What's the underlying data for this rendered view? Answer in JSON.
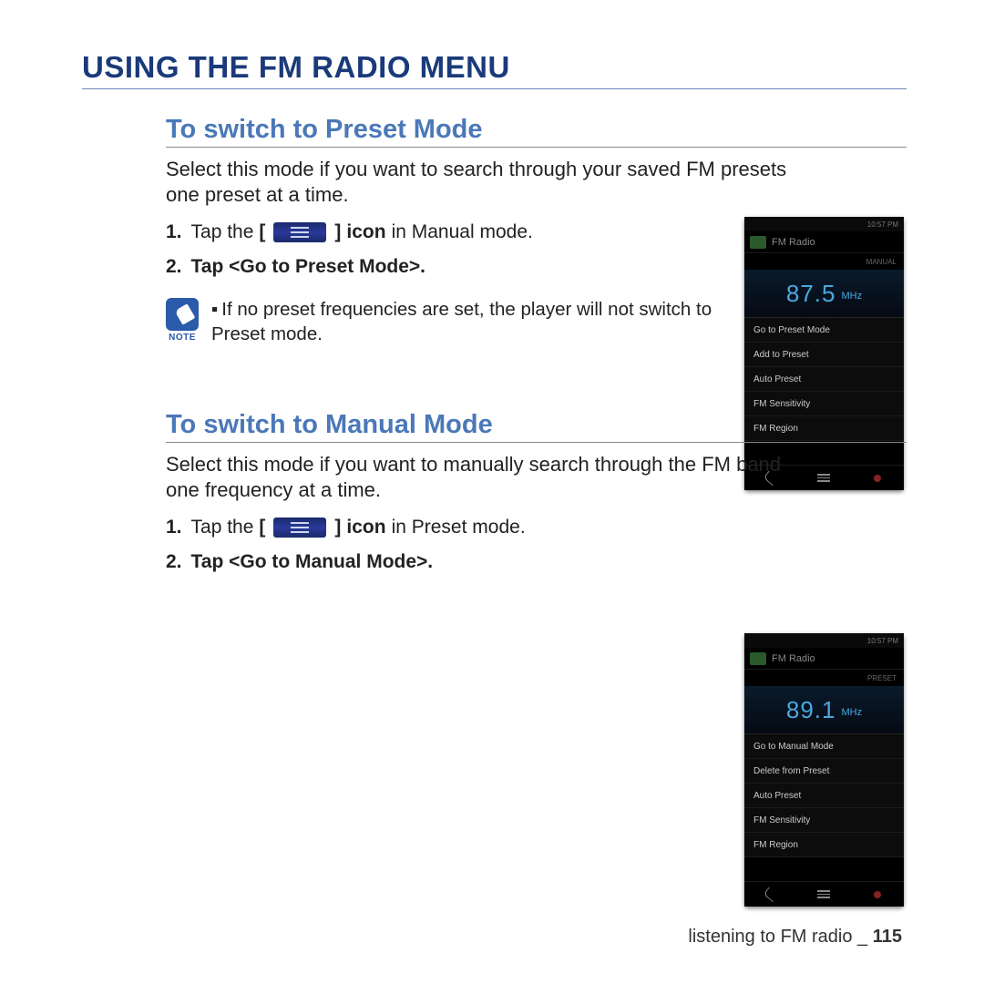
{
  "page_title": "USING THE FM RADIO MENU",
  "section1": {
    "title": "To switch to Preset Mode",
    "intro": "Select this mode if you want to search through your saved FM presets one preset at a time.",
    "step1_pre": "Tap the",
    "step1_bracket_open": "[",
    "step1_bracket_close": "]",
    "step1_icon_word": "icon",
    "step1_post": " in Manual mode.",
    "step2": "Tap <Go to Preset Mode>.",
    "note_label": "NOTE",
    "note_text": "If no preset frequencies are set, the player will not switch to Preset mode."
  },
  "section2": {
    "title": "To switch to Manual Mode",
    "intro": "Select this mode if you want to manually search through the FM band one frequency at a time.",
    "step1_pre": "Tap the",
    "step1_bracket_open": "[",
    "step1_bracket_close": "]",
    "step1_icon_word": "icon",
    "step1_post": " in Preset mode.",
    "step2": "Tap <Go to Manual Mode>."
  },
  "device1": {
    "status_time": "10:57 PM",
    "title": "FM Radio",
    "mode": "MANUAL",
    "freq": "87.5",
    "unit": "MHz",
    "menu": [
      "Go to Preset Mode",
      "Add to Preset",
      "Auto Preset",
      "FM Sensitivity",
      "FM Region"
    ]
  },
  "device2": {
    "status_time": "10:57 PM",
    "title": "FM Radio",
    "mode": "PRESET",
    "freq": "89.1",
    "unit": "MHz",
    "menu": [
      "Go to Manual Mode",
      "Delete from Preset",
      "Auto Preset",
      "FM Sensitivity",
      "FM Region"
    ]
  },
  "footer": {
    "text": "listening to FM radio _",
    "page": "115"
  }
}
